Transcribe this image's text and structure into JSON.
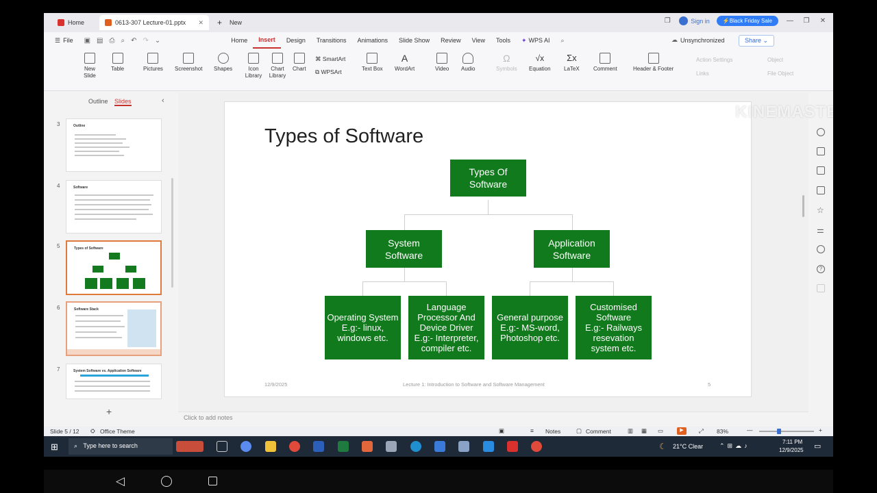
{
  "tabs": {
    "home": "Home",
    "file": "0613-307 Lecture-01.pptx",
    "new": "New"
  },
  "header": {
    "signin": "Sign in",
    "sale": "Black Friday Sale"
  },
  "menu": {
    "file": "File",
    "items": [
      "Home",
      "Insert",
      "Design",
      "Transitions",
      "Animations",
      "Slide Show",
      "Review",
      "View",
      "Tools"
    ],
    "wps_ai": "WPS AI",
    "sync": "Unsynchronized",
    "share": "Share"
  },
  "ribbon": {
    "new_slide": "New Slide",
    "table": "Table",
    "pictures": "Pictures",
    "screenshot": "Screenshot",
    "shapes": "Shapes",
    "icon_library": "Icon Library",
    "chart_library": "Chart Library",
    "chart": "Chart",
    "smartart": "SmartArt",
    "wpsart": "WPSArt",
    "text_box": "Text Box",
    "wordart": "WordArt",
    "video": "Video",
    "audio": "Audio",
    "symbols": "Symbols",
    "equation": "Equation",
    "latex": "LaTeX",
    "comment": "Comment",
    "header_footer": "Header & Footer",
    "action_settings": "Action Settings",
    "links": "Links",
    "object": "Object",
    "file_object": "File Object"
  },
  "panel": {
    "outline": "Outline",
    "slides": "Slides"
  },
  "thumbs": [
    {
      "num": "3",
      "title": "Outline"
    },
    {
      "num": "4",
      "title": "Software"
    },
    {
      "num": "5",
      "title": "Types of Software"
    },
    {
      "num": "6",
      "title": "Software Stack"
    },
    {
      "num": "7",
      "title": "System Software vs. Application Software"
    }
  ],
  "slide": {
    "title": "Types of Software",
    "root": "Types Of\nSoftware",
    "system": "System\nSoftware",
    "application": "Application\nSoftware",
    "leaf1": "Operating System\nE.g:- linux,\nwindows etc.",
    "leaf2": "Language\nProcessor And\nDevice Driver\nE.g:- Interpreter,\ncompiler etc.",
    "leaf3": "General purpose\nE.g:- MS-word,\nPhotoshop etc.",
    "leaf4": "Customised\nSoftware\nE.g:- Railways\nresevation\nsystem etc.",
    "date": "12/9/2025",
    "footer": "Lecture 1: Introduction to Software and Software Management",
    "page": "5"
  },
  "notes": "Click to add notes",
  "status": {
    "slide": "Slide 5 / 12",
    "theme": "Office Theme",
    "notes": "Notes",
    "comment": "Comment",
    "zoom": "83%"
  },
  "taskbar": {
    "search": "Type here to search",
    "weather": "21°C  Clear",
    "time": "7:11 PM",
    "date": "12/9/2025"
  },
  "watermark": "KINEMASTER"
}
